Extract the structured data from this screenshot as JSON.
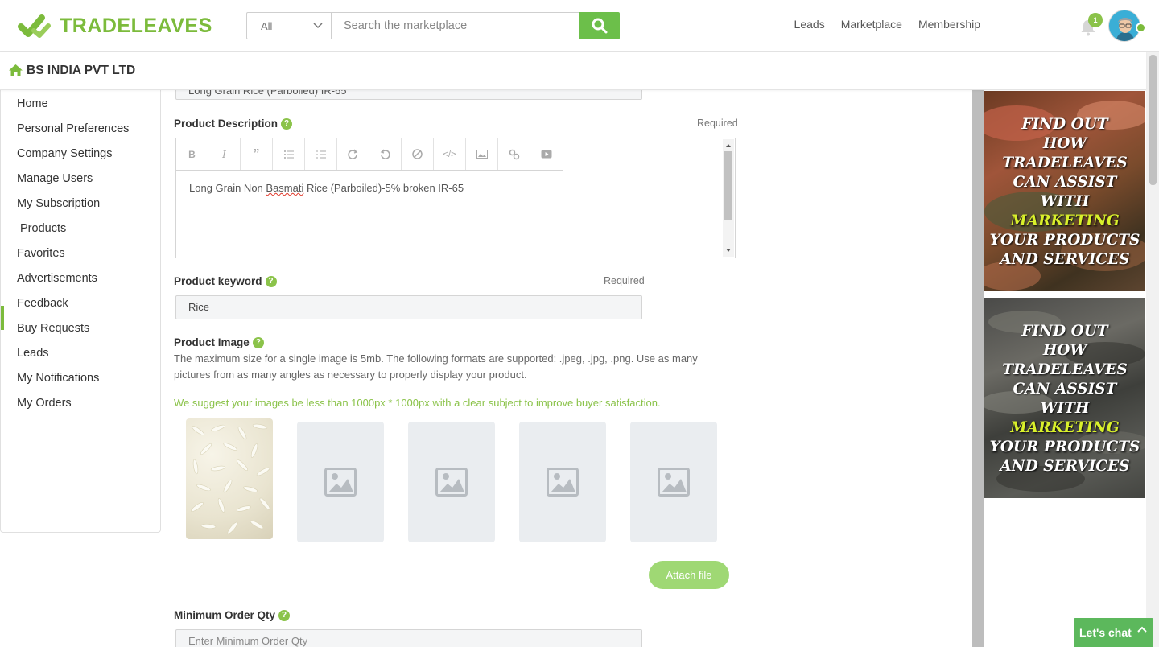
{
  "header": {
    "brand": "TRADELEAVES",
    "search": {
      "category": "All",
      "placeholder": "Search the marketplace"
    },
    "nav": [
      "Leads",
      "Marketplace",
      "Membership"
    ],
    "notification_badge": "1"
  },
  "company": {
    "name": "BS INDIA PVT LTD"
  },
  "sidebar": {
    "items": [
      "Home",
      "Personal Preferences",
      "Company Settings",
      "Manage Users",
      "My Subscription",
      "Products",
      "Favorites",
      "Advertisements",
      "Feedback",
      "Buy Requests",
      "Leads",
      "My Notifications",
      "My Orders"
    ],
    "active": "Products"
  },
  "form": {
    "product_name_value": "Long Grain Rice (Parboiled) IR-65",
    "description": {
      "label": "Product Description",
      "required": "Required",
      "text_pre": "Long Grain Non ",
      "text_misspelled": "Basmati",
      "text_post": " Rice (Parboiled)-5% broken IR-65",
      "toolbar": [
        "bold-icon",
        "italic-icon",
        "quote-icon",
        "bullet-list-icon",
        "numbered-list-icon",
        "redo-icon",
        "undo-icon",
        "clear-format-icon",
        "code-icon",
        "image-icon",
        "link-icon",
        "video-icon"
      ]
    },
    "keyword": {
      "label": "Product keyword",
      "required": "Required",
      "value": "Rice"
    },
    "image": {
      "label": "Product Image",
      "description": "The maximum size for a single image is 5mb. The following formats are supported: .jpeg, .jpg, .png. Use as many pictures from as many angles as necessary to properly display your product.",
      "suggestion": "We suggest your images be less than 1000px * 1000px with a clear subject to improve buyer satisfaction.",
      "attach_label": "Attach file"
    },
    "min_order": {
      "label": "Minimum Order Qty",
      "placeholder": "Enter Minimum Order Qty"
    }
  },
  "ads": [
    {
      "lines": [
        "FIND OUT",
        "HOW",
        "TRADELEAVES",
        "CAN ASSIST",
        "WITH"
      ],
      "highlight": "MARKETING",
      "tail": [
        "YOUR PRODUCTS",
        "AND SERVICES"
      ]
    },
    {
      "lines": [
        "FIND OUT",
        "HOW",
        "TRADELEAVES",
        "CAN ASSIST",
        "WITH"
      ],
      "highlight": "MARKETING",
      "tail": [
        "YOUR PRODUCTS",
        "AND SERVICES"
      ]
    }
  ],
  "chat": {
    "label": "Let's chat"
  },
  "colors": {
    "brand_green": "#7cbb3c",
    "search_button": "#6cbf4a",
    "attach_button": "#9fd874",
    "ad_highlight": "#d9f02b"
  }
}
